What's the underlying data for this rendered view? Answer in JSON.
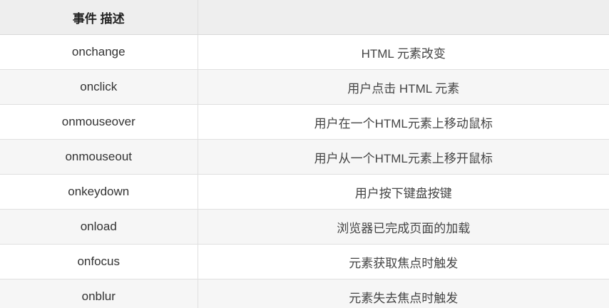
{
  "header": {
    "col1": "事件 描述",
    "col2": ""
  },
  "rows": [
    {
      "event": "onchange",
      "description": "HTML 元素改变"
    },
    {
      "event": "onclick",
      "description": "用户点击 HTML 元素"
    },
    {
      "event": "onmouseover",
      "description": "用户在一个HTML元素上移动鼠标"
    },
    {
      "event": "onmouseout",
      "description": "用户从一个HTML元素上移开鼠标"
    },
    {
      "event": "onkeydown",
      "description": "用户按下键盘按键"
    },
    {
      "event": "onload",
      "description": "浏览器已完成页面的加载"
    },
    {
      "event": "onfocus",
      "description": "元素获取焦点时触发"
    },
    {
      "event": "onblur",
      "description": "元素失去焦点时触发"
    }
  ]
}
